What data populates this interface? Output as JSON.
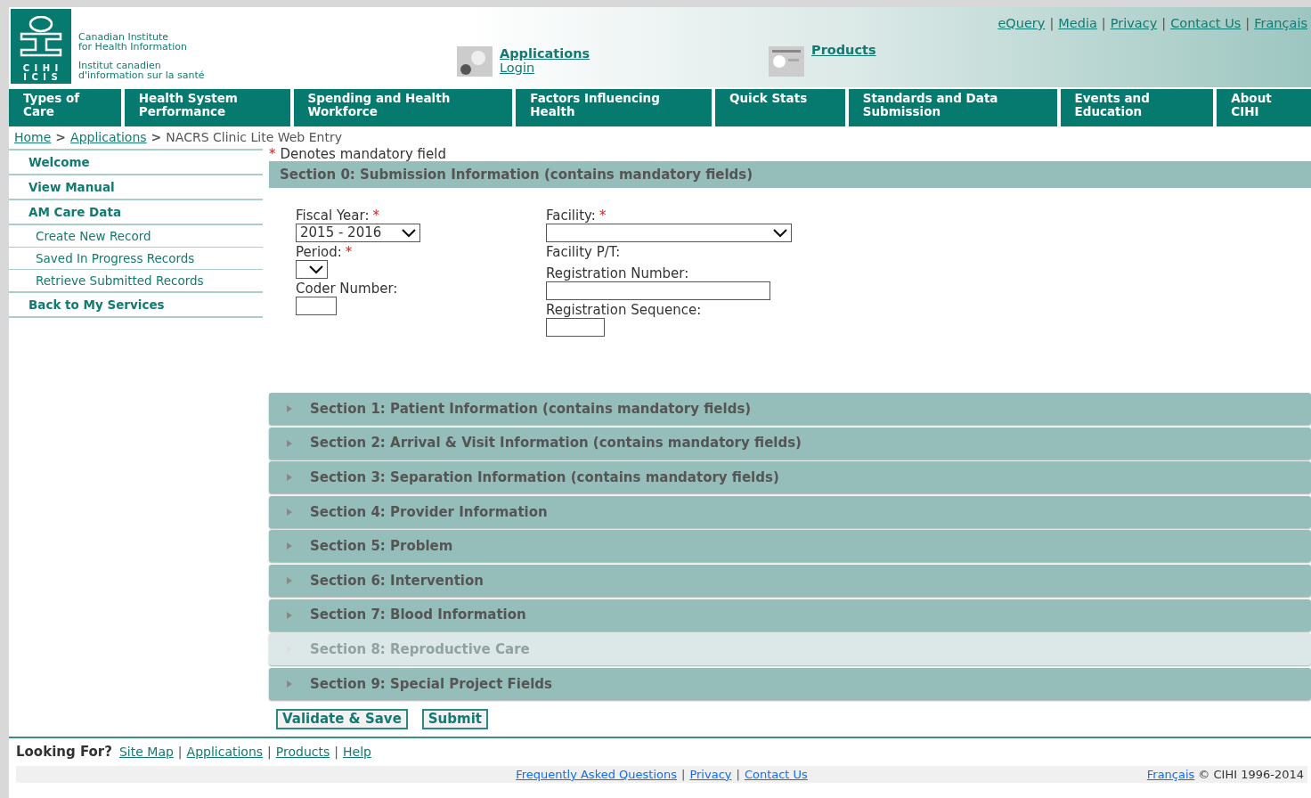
{
  "logo": {
    "abbr_en": "C I H I",
    "abbr_fr": "I C I S",
    "name_en_1": "Canadian Institute",
    "name_en_2": "for Health Information",
    "name_fr_1": "Institut canadien",
    "name_fr_2": "d'information sur la santé"
  },
  "header_links": {
    "separator": "|",
    "items": [
      "eQuery",
      "Media",
      "Privacy",
      "Contact Us",
      "Français"
    ]
  },
  "quick_links": [
    {
      "kind": "applications",
      "title": "Applications",
      "sub": "Login"
    },
    {
      "kind": "products",
      "title": "Products"
    }
  ],
  "nav": [
    "Types of Care",
    "Health System Performance",
    "Spending and Health Workforce",
    "Factors Influencing Health",
    "Quick Stats",
    "Standards and Data Submission",
    "Events and Education",
    "About CIHI"
  ],
  "breadcrumb": {
    "separator": ">",
    "links": [
      "Home",
      "Applications"
    ],
    "current": "NACRS Clinic Lite Web Entry"
  },
  "sidebar": [
    {
      "label": "Welcome"
    },
    {
      "label": "View Manual"
    },
    {
      "label": "AM Care Data",
      "children": [
        {
          "label": "Create New Record"
        },
        {
          "label": "Saved In Progress Records"
        },
        {
          "label": "Retrieve Submitted Records"
        }
      ]
    },
    {
      "label": "Back to My Services"
    }
  ],
  "mandatory_note": {
    "mark": "*",
    "text": "Denotes mandatory field"
  },
  "section0": {
    "title": "Section 0: Submission Information (contains mandatory fields)",
    "expanded": true,
    "left_fields": [
      {
        "kind": "select",
        "label": "Fiscal Year:",
        "required_mark": "*",
        "value": "2015 - 2016"
      },
      {
        "kind": "select",
        "label": "Period:",
        "required_mark": "*"
      },
      {
        "kind": "text",
        "label": "Coder Number:"
      }
    ],
    "right_fields": [
      {
        "kind": "select",
        "label": "Facility:",
        "required_mark": "*"
      },
      {
        "kind": "label",
        "label": "Facility P/T:"
      },
      {
        "kind": "text",
        "label": "Registration Number:"
      },
      {
        "kind": "text",
        "label": "Registration Sequence:"
      }
    ]
  },
  "sections": [
    {
      "title": "Section 1: Patient Information (contains mandatory fields)",
      "expanded": false,
      "disabled": false
    },
    {
      "title": "Section 2: Arrival & Visit Information (contains mandatory fields)",
      "expanded": false,
      "disabled": false
    },
    {
      "title": "Section 3: Separation Information (contains mandatory fields)",
      "expanded": false,
      "disabled": false
    },
    {
      "title": "Section 4: Provider Information",
      "expanded": false,
      "disabled": false
    },
    {
      "title": "Section 5: Problem",
      "expanded": false,
      "disabled": false
    },
    {
      "title": "Section 6: Intervention",
      "expanded": false,
      "disabled": false
    },
    {
      "title": "Section 7: Blood Information",
      "expanded": false,
      "disabled": false
    },
    {
      "title": "Section 8: Reproductive Care",
      "expanded": false,
      "disabled": true
    },
    {
      "title": "Section 9: Special Project Fields",
      "expanded": false,
      "disabled": false
    }
  ],
  "actions": [
    "Validate & Save",
    "Submit"
  ],
  "footer": {
    "looking_for": "Looking For?",
    "separator": "|",
    "links": [
      "Site Map",
      "Applications",
      "Products",
      "Help"
    ],
    "bottom_links": [
      "Frequently Asked Questions",
      "Privacy",
      "Contact Us"
    ],
    "lang_link": "Français",
    "copyright": "© CIHI 1996-2014"
  }
}
